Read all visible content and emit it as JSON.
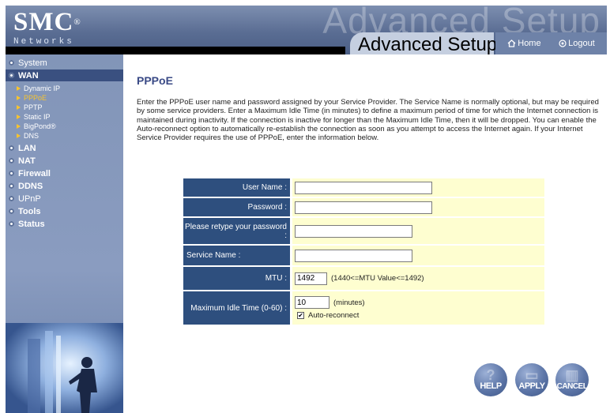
{
  "header": {
    "logo": "SMC",
    "logo_mark": "®",
    "logo_sub": "Networks",
    "watermark": "Advanced Setup",
    "title": "Advanced Setup",
    "home_label": "Home",
    "logout_label": "Logout"
  },
  "sidebar": {
    "items": [
      {
        "label": "System",
        "icon": "bullet-icon"
      },
      {
        "label": "WAN",
        "icon": "bullet-icon"
      },
      {
        "label": "LAN",
        "icon": "bullet-icon"
      },
      {
        "label": "NAT",
        "icon": "bullet-icon"
      },
      {
        "label": "Firewall",
        "icon": "bullet-icon"
      },
      {
        "label": "DDNS",
        "icon": "bullet-icon"
      },
      {
        "label": "UPnP",
        "icon": "bullet-icon"
      },
      {
        "label": "Tools",
        "icon": "bullet-icon"
      },
      {
        "label": "Status",
        "icon": "bullet-icon"
      }
    ],
    "wan_sub": [
      {
        "label": "Dynamic IP"
      },
      {
        "label": "PPPoE"
      },
      {
        "label": "PPTP"
      },
      {
        "label": "Static IP"
      },
      {
        "label": "BigPond®"
      },
      {
        "label": "DNS"
      }
    ]
  },
  "main": {
    "title": "PPPoE",
    "description": "Enter the PPPoE user name and password assigned by your Service Provider. The Service Name is normally optional, but may be required by some service providers. Enter a Maximum Idle Time (in minutes) to define a maximum period of time for which the Internet connection is maintained during inactivity. If the connection is inactive for longer than the Maximum Idle Time, then it will be dropped. You can enable the Auto-reconnect option to automatically re-establish the connection as soon as you attempt to access the Internet again. If your Internet Service Provider requires the use of PPPoE, enter the information below."
  },
  "form": {
    "username_label": "User Name :",
    "username_value": "",
    "password_label": "Password :",
    "password_value": "",
    "retype_label": "Please retype your password :",
    "retype_value": "",
    "service_label": "Service Name :",
    "service_value": "",
    "mtu_label": "MTU :",
    "mtu_value": "1492",
    "mtu_hint": "(1440<=MTU Value<=1492)",
    "idle_label": "Maximum Idle Time (0-60) :",
    "idle_value": "10",
    "idle_unit": "(minutes)",
    "autoreconnect_label": "Auto-reconnect",
    "autoreconnect_checked": true
  },
  "buttons": {
    "help": "HELP",
    "apply": "APPLY",
    "cancel": "CANCEL"
  },
  "colors": {
    "header": "#5a6d93",
    "sidebar": "#8295b8",
    "label_bg": "#2e4f7e",
    "value_bg": "#fefed0",
    "title": "#3a4a86",
    "highlight": "#f7c32f"
  }
}
